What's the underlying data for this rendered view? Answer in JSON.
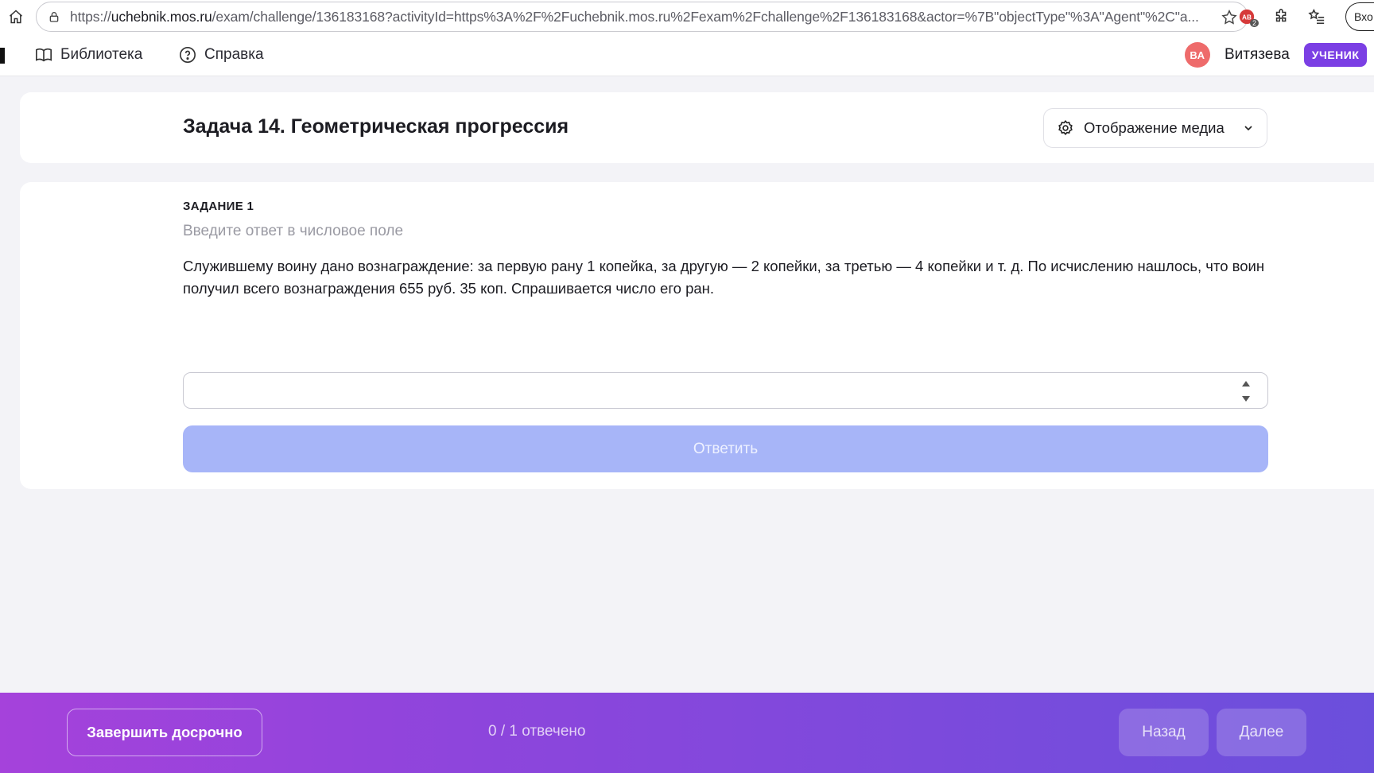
{
  "browser": {
    "url_prefix": "https://",
    "url_domain": "uchebnik.mos.ru",
    "url_rest": "/exam/challenge/136183168?activityId=https%3A%2F%2Fuchebnik.mos.ru%2Fexam%2Fchallenge%2F136183168&actor=%7B\"objectType\"%3A\"Agent\"%2C\"a...",
    "ext_badge": "2",
    "profile_label": "Вхо"
  },
  "nav": {
    "library_label": "Библиотека",
    "help_label": "Справка",
    "avatar_initials": "ВА",
    "user_name": "Витязева",
    "role_badge": "УЧЕНИК"
  },
  "header": {
    "title": "Задача 14. Геометрическая прогрессия",
    "media_label": "Отображение медиа"
  },
  "task": {
    "label": "ЗАДАНИЕ 1",
    "hint": "Введите ответ в числовое поле",
    "text": "Служившему воину дано вознаграждение: за первую рану 1 копейка, за другую — 2 копейки, за третью — 4 копейки и т. д. По исчислению нашлось, что воин получил всего вознаграждения 655 руб. 35 коп. Спрашивается число его ран.",
    "answer_value": "",
    "submit_label": "Ответить"
  },
  "footer": {
    "finish_label": "Завершить досрочно",
    "progress_text": "0 / 1 отвечено",
    "back_label": "Назад",
    "next_label": "Далее"
  },
  "colors": {
    "accent": "#7b3fe4",
    "submit_disabled": "#a7b5f8",
    "footer_start": "#a542db",
    "footer_end": "#6b4fdc",
    "avatar": "#ee6b6b"
  }
}
